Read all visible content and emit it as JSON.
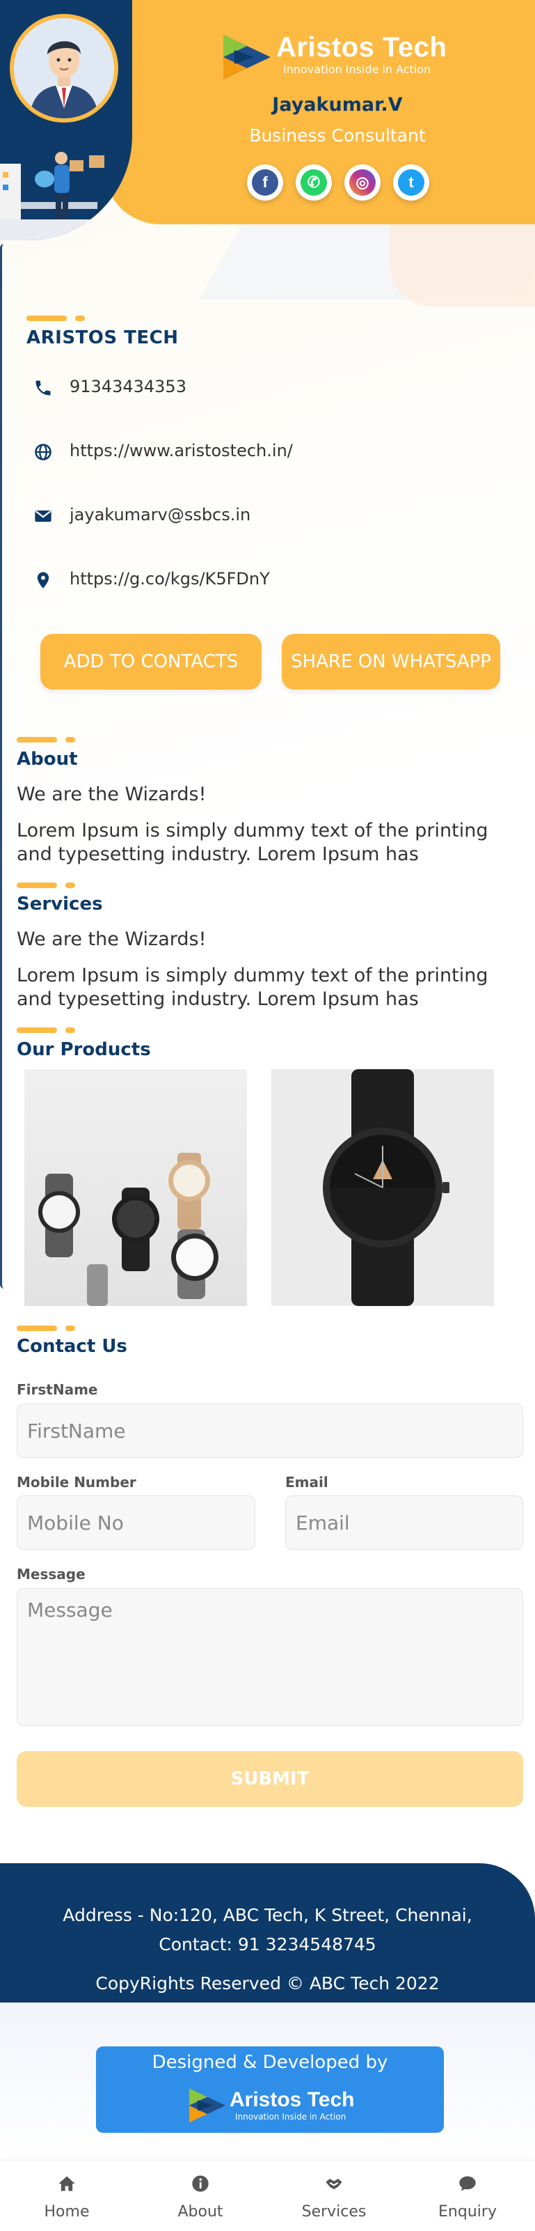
{
  "header": {
    "brand_name": "Aristos Tech",
    "brand_tagline": "Innovation Inside in Action",
    "person_name": "Jayakumar.V",
    "person_role": "Business Consultant",
    "socials": [
      {
        "label": "f",
        "icon": "facebook-icon",
        "color": "#3b5998"
      },
      {
        "label": "✆",
        "icon": "whatsapp-icon",
        "color": "#25d366"
      },
      {
        "label": "◎",
        "icon": "instagram-icon",
        "color": "#c13584"
      },
      {
        "label": "t",
        "icon": "twitter-icon",
        "color": "#1da1f2"
      }
    ]
  },
  "company": {
    "name": "ARISTOS TECH",
    "contacts": [
      {
        "icon": "phone-icon",
        "text": "91343434353"
      },
      {
        "icon": "globe-icon",
        "text": "https://www.aristostech.in/"
      },
      {
        "icon": "mail-icon",
        "text": "jayakumarv@ssbcs.in"
      },
      {
        "icon": "location-pin-icon",
        "text": "https://g.co/kgs/K5FDnY"
      }
    ],
    "add_contacts_label": "ADD TO CONTACTS",
    "share_whatsapp_label": "SHARE ON WHATSAPP"
  },
  "about": {
    "title": "About",
    "line1": "We are the Wizards!",
    "body": "Lorem Ipsum is simply dummy text of the printing and typesetting industry. Lorem Ipsum has"
  },
  "services": {
    "title": "Services",
    "line1": "We are the Wizards!",
    "body": "Lorem Ipsum is simply dummy text of the printing and typesetting industry. Lorem Ipsum has"
  },
  "products": {
    "title": "Our Products"
  },
  "contact_form": {
    "title": "Contact Us",
    "firstname_label": "FirstName",
    "firstname_placeholder": "FirstName",
    "mobile_label": "Mobile Number",
    "mobile_placeholder": "Mobile No",
    "email_label": "Email",
    "email_placeholder": "Email",
    "message_label": "Message",
    "message_placeholder": "Message",
    "submit_label": "SUBMIT"
  },
  "footer": {
    "address_line1": "Address - No:120, ABC Tech, K Street, Chennai,",
    "address_line2": "Contact: 91 3234548745",
    "copyright": "CopyRights Reserved © ABC Tech 2022"
  },
  "credit": {
    "text": "Designed & Developed by",
    "brand_name": "Aristos Tech",
    "brand_tagline": "Innovation Inside in Action"
  },
  "bottom_nav": [
    {
      "label": "Home",
      "icon": "home-icon"
    },
    {
      "label": "About",
      "icon": "info-icon"
    },
    {
      "label": "Services",
      "icon": "handshake-icon"
    },
    {
      "label": "Enquiry",
      "icon": "chat-icon"
    }
  ],
  "colors": {
    "navy": "#0d3a69",
    "accent_yellow": "#fdba43",
    "credit_blue": "#2f8ee8"
  }
}
